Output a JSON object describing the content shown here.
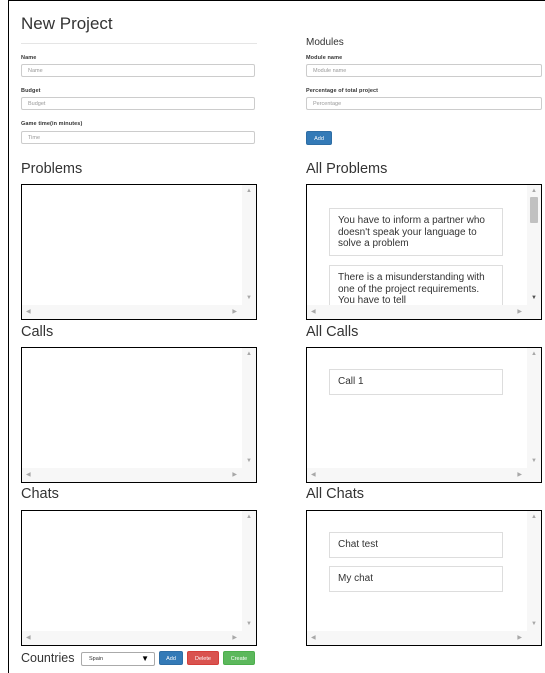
{
  "page": {
    "title": "New Project",
    "modules_title": "Modules"
  },
  "form": {
    "name": {
      "label": "Name",
      "placeholder": "Name"
    },
    "budget": {
      "label": "Budget",
      "placeholder": "Budget"
    },
    "game_time": {
      "label": "Game time(in minutes)",
      "placeholder": "Time"
    }
  },
  "modules_form": {
    "module_name": {
      "label": "Module name",
      "placeholder": "Module name"
    },
    "percentage": {
      "label": "Percentage of total project",
      "placeholder": "Percentage"
    },
    "add_label": "Add"
  },
  "sections": {
    "problems": "Problems",
    "all_problems": "All Problems",
    "calls": "Calls",
    "all_calls": "All Calls",
    "chats": "Chats",
    "all_chats": "All Chats"
  },
  "all_problems_items": [
    "You have to inform a partner who doesn't speak your language to solve a problem",
    "There is a misunderstanding with one of the project requirements. You have to tell"
  ],
  "all_calls_items": [
    "Call 1"
  ],
  "all_chats_items": [
    "Chat test",
    "My chat"
  ],
  "countries": {
    "label": "Countries",
    "selected": "Spain",
    "add_label": "Add",
    "delete_label": "Delete",
    "create_label": "Create"
  },
  "icons": {
    "scroll_up": "▲",
    "scroll_down": "▼",
    "scroll_left": "◀",
    "scroll_right": "▶",
    "select_caret": "▼"
  },
  "colors": {
    "primary": "#337ab7",
    "danger": "#d9534f",
    "success": "#5cb85c"
  }
}
